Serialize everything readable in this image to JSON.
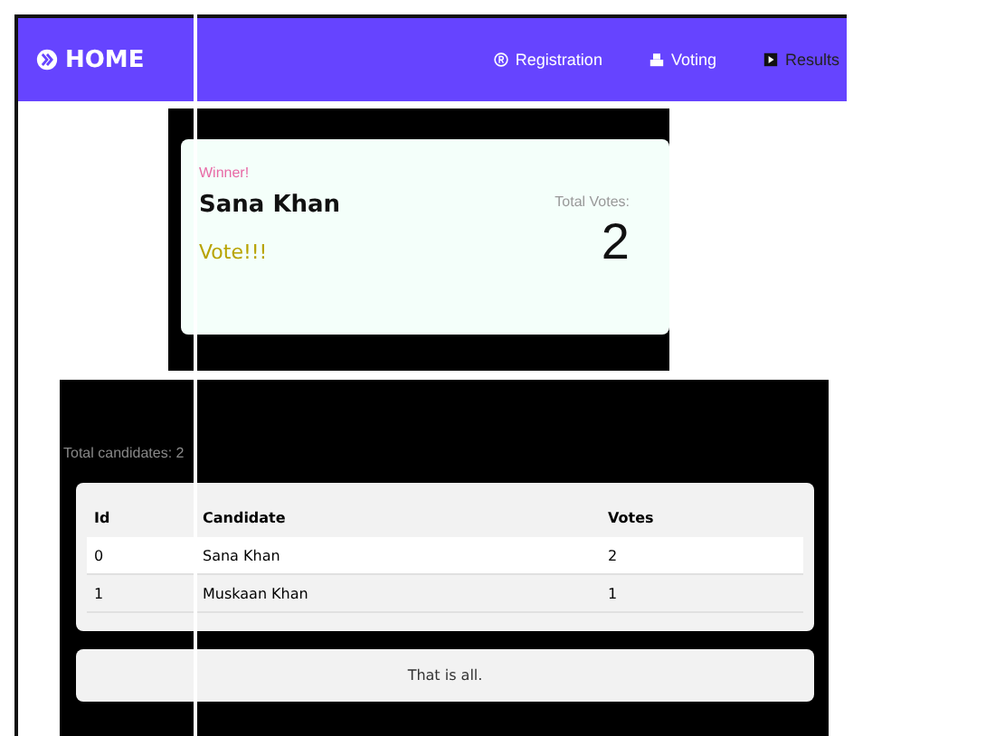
{
  "navbar": {
    "brand": "HOME",
    "links": [
      {
        "label": "Registration"
      },
      {
        "label": "Voting"
      },
      {
        "label": "Results"
      }
    ]
  },
  "winner": {
    "label": "Winner!",
    "name": "Sana Khan",
    "message": "Vote!!!",
    "votes_label": "Total Votes:",
    "votes": "2"
  },
  "results": {
    "total": "Total candidates: 2",
    "columns": [
      "Id",
      "Candidate",
      "Votes"
    ],
    "rows": [
      {
        "cells": [
          "0",
          "Sana Khan",
          "2"
        ],
        "selected": true
      },
      {
        "cells": [
          "1",
          "Muskaan Khan",
          "1"
        ],
        "selected": false
      }
    ],
    "footer": "That is all."
  }
}
